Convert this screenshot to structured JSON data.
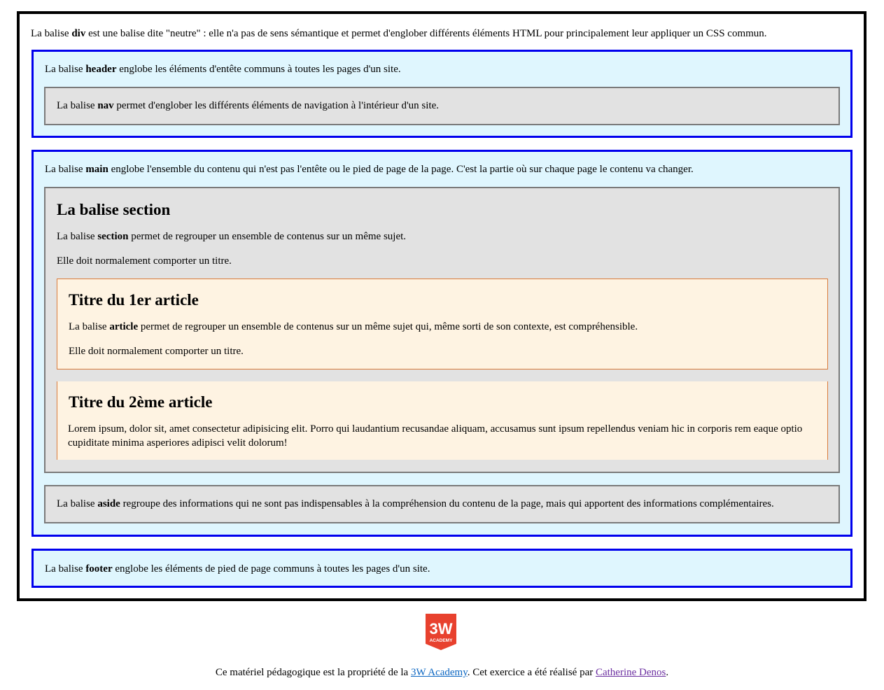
{
  "div_block": {
    "pre": "La balise ",
    "tag": "div",
    "post": " est une balise dite \"neutre\" : elle n'a pas de sens sémantique et permet d'englober différents éléments HTML pour principalement leur appliquer un CSS commun."
  },
  "header_block": {
    "pre": "La balise ",
    "tag": "header",
    "post": " englobe les éléments d'entête communs à toutes les pages d'un site.",
    "nav": {
      "pre": "La balise ",
      "tag": "nav",
      "post": " permet d'englober les différents éléments de navigation à l'intérieur d'un site."
    }
  },
  "main_block": {
    "pre": "La balise ",
    "tag": "main",
    "post": " englobe l'ensemble du contenu qui n'est pas l'entête ou le pied de page de la page. C'est la partie où sur chaque page le contenu va changer.",
    "section": {
      "title": "La balise section",
      "p1_pre": "La balise ",
      "p1_tag": "section",
      "p1_post": " permet de regrouper un ensemble de contenus sur un même sujet.",
      "p2": "Elle doit normalement comporter un titre.",
      "articles": [
        {
          "title": "Titre du 1er article",
          "p1_pre": "La balise ",
          "p1_tag": "article",
          "p1_post": " permet de regrouper un ensemble de contenus sur un même sujet qui, même sorti de son contexte, est compréhensible.",
          "p2": "Elle doit normalement comporter un titre."
        },
        {
          "title": "Titre du 2ème article",
          "p1": "Lorem ipsum, dolor sit, amet consectetur adipisicing elit. Porro qui laudantium recusandae aliquam, accusamus sunt ipsum repellendus veniam hic in corporis rem eaque optio cupiditate minima asperiores adipisci velit dolorum!"
        }
      ]
    },
    "aside": {
      "pre": "La balise ",
      "tag": "aside",
      "post": " regroupe des informations qui ne sont pas indispensables à la compréhension du contenu de la page, mais qui apportent des informations complémentaires."
    }
  },
  "footer_block": {
    "pre": "La balise ",
    "tag": "footer",
    "post": " englobe les éléments de pied de page communs à toutes les pages d'un site."
  },
  "logo": {
    "top": "3W",
    "bottom": "ACADEMY",
    "color": "#e8412e"
  },
  "credits": {
    "pre": "Ce matériel pédagogique est la propriété de la ",
    "link1": "3W Academy",
    "mid": ". Cet exercice a été réalisé par ",
    "link2": "Catherine Denos",
    "post": "."
  },
  "colors": {
    "blue_border": "#0000ee",
    "blue_bg": "#dff6fe",
    "grey_bg": "#e2e2e2",
    "orange_bg": "#fef3e2",
    "orange_border": "#d97a3a"
  }
}
